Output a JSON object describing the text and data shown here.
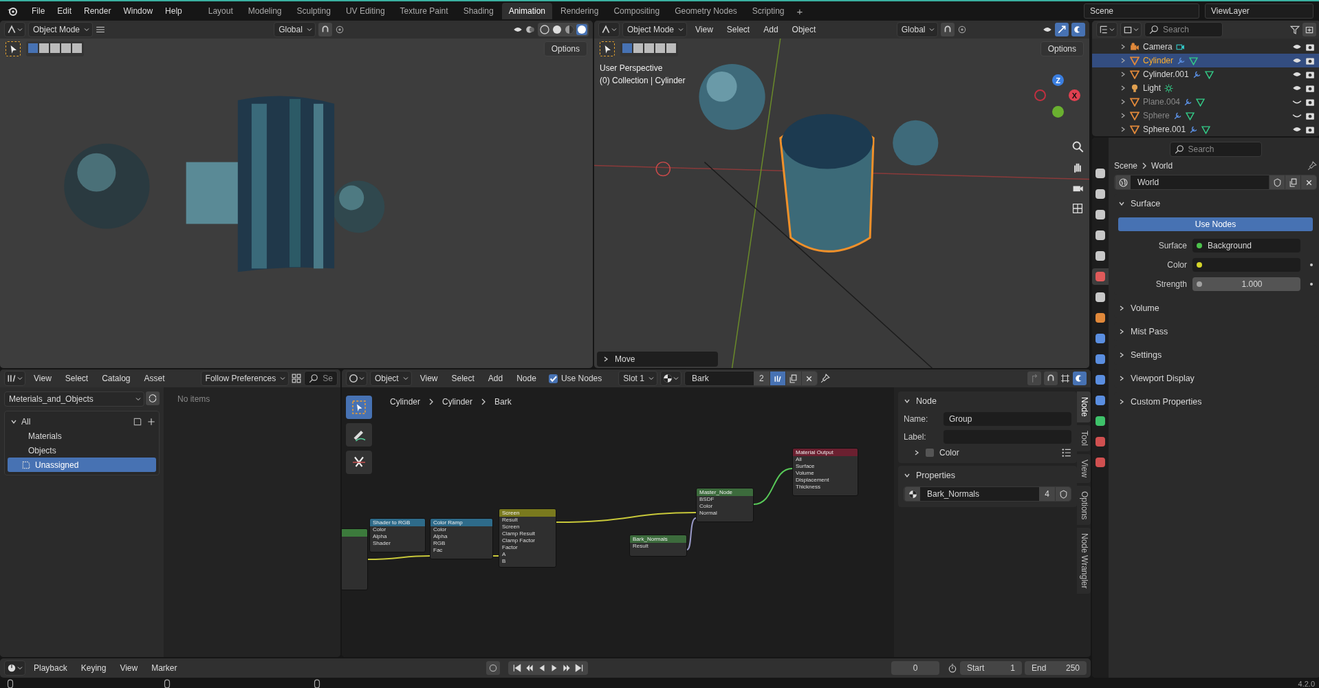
{
  "menu": [
    "File",
    "Edit",
    "Render",
    "Window",
    "Help"
  ],
  "workspaces": [
    {
      "label": "Layout",
      "selected": false
    },
    {
      "label": "Modeling",
      "selected": false
    },
    {
      "label": "Sculpting",
      "selected": false
    },
    {
      "label": "UV Editing",
      "selected": false
    },
    {
      "label": "Texture Paint",
      "selected": false
    },
    {
      "label": "Shading",
      "selected": false
    },
    {
      "label": "Animation",
      "selected": true
    },
    {
      "label": "Rendering",
      "selected": false
    },
    {
      "label": "Compositing",
      "selected": false
    },
    {
      "label": "Geometry Nodes",
      "selected": false
    },
    {
      "label": "Scripting",
      "selected": false
    }
  ],
  "add_workspace": "+",
  "scene": "Scene",
  "view_layer": "ViewLayer",
  "viewport_left": {
    "mode": "Object Mode",
    "orientation": "Global",
    "options": "Options"
  },
  "viewport_right": {
    "mode": "Object Mode",
    "menus": [
      "View",
      "Select",
      "Add",
      "Object"
    ],
    "orientation": "Global",
    "options": "Options",
    "overlay_text": [
      "User Perspective",
      "(0) Collection | Cylinder"
    ],
    "gizmo_axes": [
      "Z",
      "X"
    ],
    "last_operator": "Move"
  },
  "outliner": {
    "search_placeholder": "Search",
    "items": [
      {
        "name": "Camera",
        "kind": "camera",
        "selected": false,
        "visible": true
      },
      {
        "name": "Cylinder",
        "kind": "mesh",
        "selected": true,
        "visible": true
      },
      {
        "name": "Cylinder.001",
        "kind": "mesh",
        "selected": false,
        "visible": true
      },
      {
        "name": "Light",
        "kind": "light",
        "selected": false,
        "visible": true
      },
      {
        "name": "Plane.004",
        "kind": "mesh",
        "selected": false,
        "visible": false
      },
      {
        "name": "Sphere",
        "kind": "mesh",
        "selected": false,
        "visible": false
      },
      {
        "name": "Sphere.001",
        "kind": "mesh",
        "selected": false,
        "visible": true
      }
    ]
  },
  "properties": {
    "search_placeholder": "Search",
    "tabs": [
      {
        "kind": "tool",
        "selected": false
      },
      {
        "kind": "render",
        "selected": false
      },
      {
        "kind": "output",
        "selected": false
      },
      {
        "kind": "view_layer",
        "selected": false
      },
      {
        "kind": "scene",
        "selected": false
      },
      {
        "kind": "world",
        "selected": true
      },
      {
        "kind": "collection",
        "selected": false
      },
      {
        "kind": "object",
        "selected": false
      },
      {
        "kind": "modifier",
        "selected": false
      },
      {
        "kind": "particles",
        "selected": false
      },
      {
        "kind": "physics",
        "selected": false
      },
      {
        "kind": "constraints",
        "selected": false
      },
      {
        "kind": "data",
        "selected": false
      },
      {
        "kind": "material",
        "selected": false
      },
      {
        "kind": "texture",
        "selected": false
      }
    ],
    "breadcrumb": [
      "Scene",
      "World"
    ],
    "datablock": "World",
    "surface_panel": {
      "title": "Surface",
      "expanded": true,
      "use_nodes": "Use Nodes",
      "fields": [
        {
          "label": "Surface",
          "value": "Background",
          "color": "#4cc24c",
          "kind": "link"
        },
        {
          "label": "Color",
          "color": "#d4d42a",
          "kind": "color"
        },
        {
          "label": "Strength",
          "value": "1.000",
          "color": "#a1a1a1",
          "kind": "number"
        }
      ]
    },
    "panels": [
      {
        "title": "Volume",
        "expanded": false
      },
      {
        "title": "Mist Pass",
        "expanded": false
      },
      {
        "title": "Settings",
        "expanded": false
      },
      {
        "title": "Viewport Display",
        "expanded": false
      },
      {
        "title": "Custom Properties",
        "expanded": false
      }
    ]
  },
  "asset_browser": {
    "menus": [
      "View",
      "Select",
      "Catalog",
      "Asset"
    ],
    "import_method": "Follow Preferences",
    "search_placeholder": "Se",
    "library": "Meterials_and_Objects",
    "catalogs": [
      {
        "name": "All",
        "expanded": true,
        "selected": false,
        "children": [
          {
            "name": "Materials",
            "selected": false
          },
          {
            "name": "Objects",
            "selected": false
          },
          {
            "name": "Unassigned",
            "selected": true
          }
        ]
      }
    ],
    "empty_text": "No items"
  },
  "node_editor": {
    "type": "Object",
    "menus": [
      "View",
      "Select",
      "Add",
      "Node"
    ],
    "use_nodes": {
      "label": "Use Nodes",
      "checked": true
    },
    "slot": "Slot 1",
    "material": "Bark",
    "users": "2",
    "breadcrumb": [
      "Cylinder",
      "Cylinder",
      "Bark"
    ],
    "nodes": [
      {
        "color": "#3c7a3c"
      },
      {
        "title": "Shader to RGB",
        "color": "#2e6b8a",
        "rows": [
          "Color",
          "Alpha",
          "Shader"
        ]
      },
      {
        "title": "Color Ramp",
        "color": "#2e6b8a",
        "rows": [
          "Color",
          "Alpha",
          "RGB",
          "Fac"
        ]
      },
      {
        "title": "Screen",
        "color": "#7a7a1e",
        "rows": [
          "Result",
          "Screen",
          "Clamp Result",
          "Clamp Factor",
          "Factor",
          "A",
          "B"
        ]
      },
      {
        "title": "Bark_Normals",
        "color": "#3c6b3c",
        "rows": [
          "Result"
        ]
      },
      {
        "title": "Master_Node",
        "color": "#3c6b3c",
        "rows": [
          "BSDF",
          "Color",
          "Normal"
        ]
      },
      {
        "title": "Material Output",
        "color": "#6b2030",
        "rows": [
          "All",
          "Surface",
          "Volume",
          "Displacement",
          "Thickness"
        ]
      }
    ],
    "sidebar": {
      "tabs": [
        {
          "label": "Node",
          "selected": true
        },
        {
          "label": "Tool",
          "selected": false
        },
        {
          "label": "View",
          "selected": false
        },
        {
          "label": "Options",
          "selected": false
        },
        {
          "label": "Node Wrangler",
          "selected": false
        }
      ],
      "node_panel": {
        "title": "Node",
        "name_label": "Name:",
        "name": "Group",
        "label_label": "Label:",
        "color_label": "Color",
        "color_enabled": false
      },
      "properties_panel": {
        "title": "Properties",
        "node_tree": "Bark_Normals",
        "users": "4"
      }
    }
  },
  "timeline": {
    "menus": [
      "Playback",
      "Keying",
      "View",
      "Marker"
    ],
    "current_frame": "0",
    "start_label": "Start",
    "start": "1",
    "end_label": "End",
    "end": "250"
  },
  "status_bar": {
    "version": "4.2.0"
  }
}
